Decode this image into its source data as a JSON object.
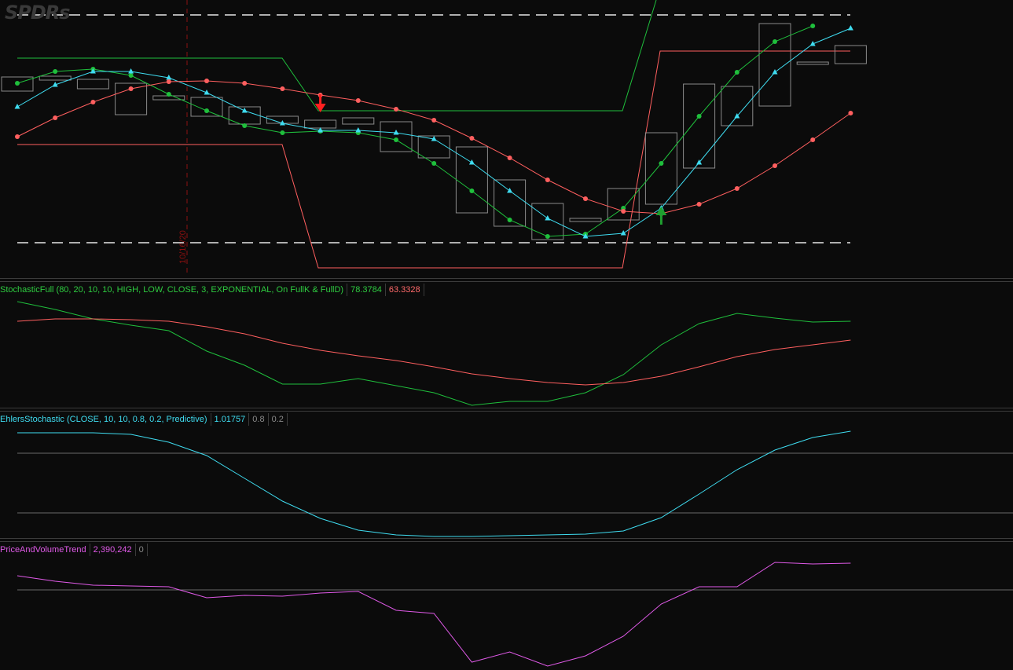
{
  "logo": "SPDRs",
  "date_label": "10/16/20",
  "panels": {
    "stoch": {
      "name": "StochasticFull (80, 20, 10, 10, HIGH, LOW, CLOSE, 3, EXPONENTIAL, On FullK & FullD)",
      "v1": "78.3784",
      "v2": "63.3328"
    },
    "ehlers": {
      "name": "EhlersStochastic (CLOSE, 10, 10, 0.8, 0.2, Predictive)",
      "v1": "1.01757",
      "v2": "0.8",
      "v3": "0.2"
    },
    "pvt": {
      "name": "PriceAndVolumeTrend",
      "v1": "2,390,242",
      "v2": "0"
    }
  },
  "colors": {
    "green": "#1fbf3c",
    "red": "#ff5f5f",
    "cyan": "#3fdcf0",
    "magenta": "#e05ae8",
    "candle": "#8a8a8a",
    "stoch_label": "#2ecc40",
    "ehlers_label": "#3fdcf0",
    "pvt_label": "#e05ae8",
    "gray": "#9a9a9a"
  },
  "chart_data": [
    {
      "type": "line",
      "panel": "price",
      "x": [
        0,
        1,
        2,
        3,
        4,
        5,
        6,
        7,
        8,
        9,
        10,
        11,
        12,
        13,
        14,
        15,
        16,
        17,
        18,
        19,
        20,
        21,
        22
      ],
      "candles": [
        [
          0,
          98,
          116
        ],
        [
          1,
          97,
          102
        ],
        [
          2,
          101,
          113
        ],
        [
          3,
          106,
          146
        ],
        [
          4,
          122,
          127
        ],
        [
          5,
          124,
          148
        ],
        [
          6,
          136,
          158
        ],
        [
          7,
          148,
          157
        ],
        [
          8,
          153,
          163
        ],
        [
          9,
          150,
          158
        ],
        [
          10,
          155,
          193
        ],
        [
          11,
          173,
          201
        ],
        [
          12,
          187,
          271
        ],
        [
          13,
          229,
          288
        ],
        [
          14,
          259,
          305
        ],
        [
          15,
          278,
          282
        ],
        [
          16,
          240,
          280
        ],
        [
          17,
          169,
          260
        ],
        [
          18,
          107,
          214
        ],
        [
          19,
          110,
          160
        ],
        [
          20,
          30,
          135
        ],
        [
          21,
          79,
          82
        ],
        [
          22,
          58,
          81
        ]
      ],
      "series": [
        {
          "color": "green",
          "marker": "dot",
          "values": [
            106,
            91,
            88,
            96,
            120,
            141,
            160,
            169,
            167,
            169,
            178,
            208,
            243,
            280,
            301,
            298,
            265,
            208,
            148,
            92,
            53,
            33,
            null
          ]
        },
        {
          "color": "cyan",
          "marker": "tri",
          "values": [
            136,
            108,
            91,
            91,
            99,
            118,
            141,
            157,
            166,
            166,
            169,
            177,
            207,
            243,
            278,
            301,
            297,
            265,
            207,
            148,
            92,
            56,
            36
          ]
        },
        {
          "color": "red",
          "marker": "dot",
          "values": [
            174,
            150,
            130,
            113,
            104,
            103,
            106,
            113,
            121,
            128,
            139,
            153,
            176,
            201,
            229,
            253,
            269,
            272,
            260,
            240,
            211,
            178,
            144
          ]
        }
      ],
      "bands": {
        "green": [
          [
            22,
            74
          ],
          [
            359,
            74
          ],
          [
            405,
            141
          ],
          [
            792,
            141
          ],
          [
            835,
            0
          ]
        ],
        "red": [
          [
            22,
            184
          ],
          [
            359,
            184
          ],
          [
            405,
            341
          ],
          [
            792,
            341
          ],
          [
            840,
            65
          ],
          [
            1082,
            65
          ]
        ]
      },
      "levels": [
        19,
        309
      ],
      "signals": [
        {
          "type": "sell",
          "bar": 8
        },
        {
          "type": "buy",
          "bar": 17
        }
      ]
    },
    {
      "type": "line",
      "panel": "stoch",
      "series": [
        {
          "color": "green",
          "values": [
            384,
            394,
            406,
            414,
            421,
            447,
            465,
            489,
            489,
            482,
            491,
            500,
            516,
            511,
            511,
            500,
            477,
            439,
            412,
            399,
            405,
            410,
            409
          ]
        },
        {
          "color": "red",
          "values": [
            409,
            406,
            406,
            407,
            409,
            416,
            425,
            437,
            446,
            453,
            459,
            467,
            476,
            482,
            487,
            490,
            487,
            479,
            467,
            454,
            445,
            439,
            433
          ]
        }
      ]
    },
    {
      "type": "line",
      "panel": "ehlers",
      "series": [
        {
          "color": "cyan",
          "values": [
            551,
            551,
            551,
            553,
            563,
            580,
            609,
            638,
            660,
            675,
            681,
            683,
            683,
            682,
            681,
            680,
            676,
            659,
            629,
            598,
            573,
            557,
            549
          ]
        }
      ]
    },
    {
      "type": "line",
      "panel": "pvt",
      "series": [
        {
          "color": "magenta",
          "values": [
            733,
            740,
            745,
            746,
            747,
            761,
            758,
            759,
            755,
            753,
            777,
            781,
            843,
            830,
            848,
            835,
            810,
            769,
            747,
            747,
            716,
            718,
            717
          ]
        }
      ]
    }
  ]
}
